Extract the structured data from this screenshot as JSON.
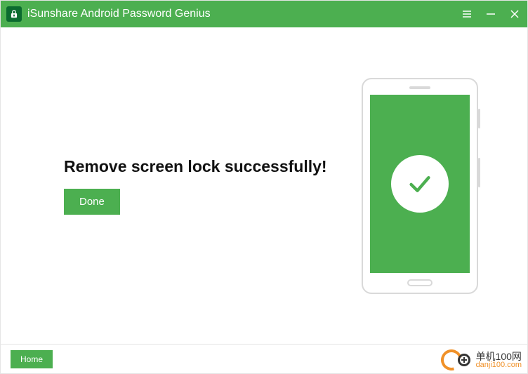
{
  "titlebar": {
    "app_name": "iSunshare Android Password Genius"
  },
  "main": {
    "headline": "Remove screen lock successfully!",
    "done_label": "Done"
  },
  "footer": {
    "home_label": "Home"
  },
  "watermark": {
    "line1": "单机100网",
    "line2": "danji100.com"
  },
  "colors": {
    "brand_green": "#4caf50",
    "accent_orange": "#f08c1e"
  }
}
